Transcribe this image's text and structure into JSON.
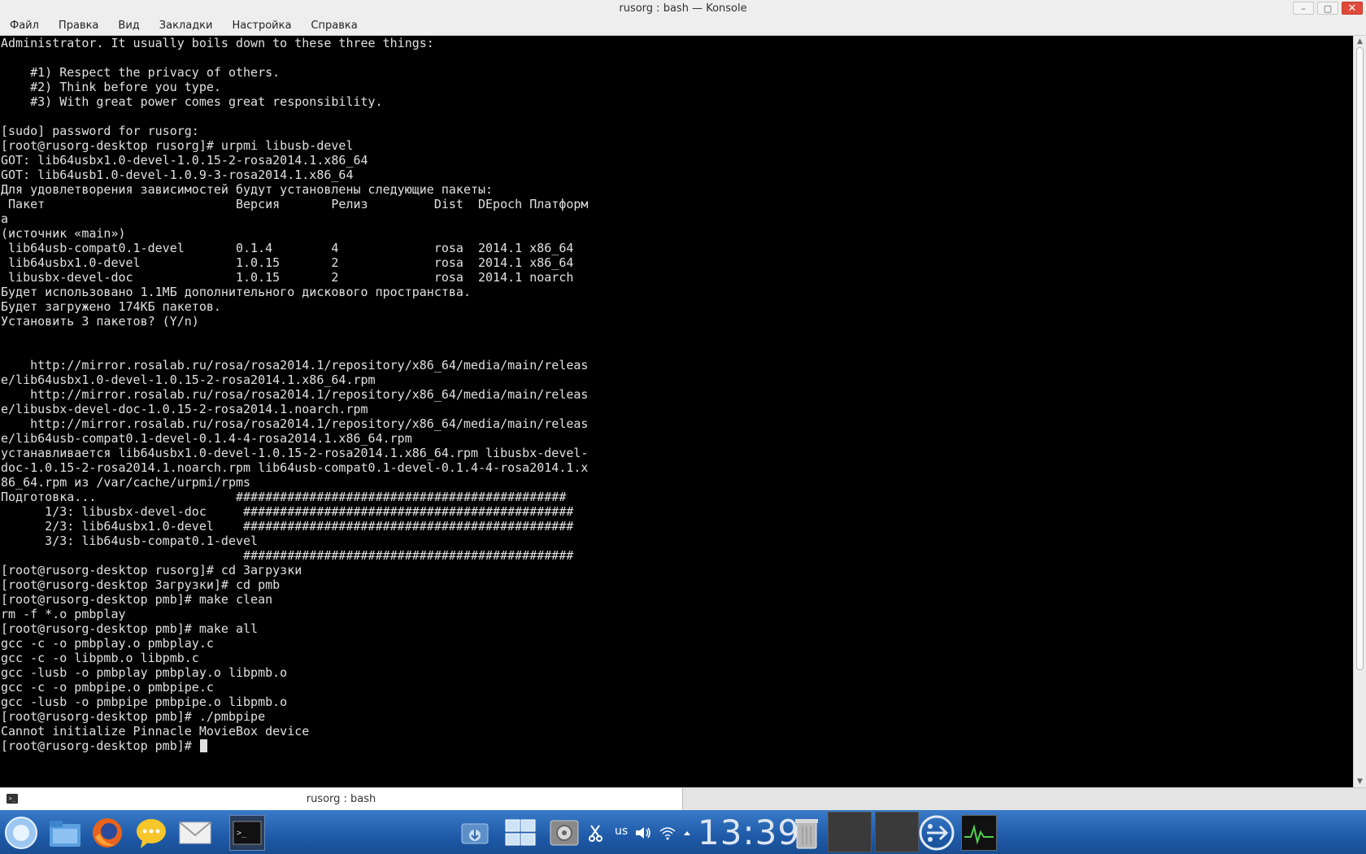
{
  "window": {
    "title": "rusorg : bash — Konsole",
    "controls": {
      "minimize": "–",
      "maximize": "▢",
      "close": "✕"
    }
  },
  "menubar": {
    "items": [
      "Файл",
      "Правка",
      "Вид",
      "Закладки",
      "Настройка",
      "Справка"
    ]
  },
  "terminal": {
    "lines": [
      "Administrator. It usually boils down to these three things:",
      "",
      "    #1) Respect the privacy of others.",
      "    #2) Think before you type.",
      "    #3) With great power comes great responsibility.",
      "",
      "[sudo] password for rusorg:",
      "[root@rusorg-desktop rusorg]# urpmi libusb-devel",
      "GOT: lib64usbx1.0-devel-1.0.15-2-rosa2014.1.x86_64",
      "GOT: lib64usb1.0-devel-1.0.9-3-rosa2014.1.x86_64",
      "Для удовлетворения зависимостей будут установлены следующие пакеты:",
      " Пакет                          Версия       Релиз         Dist  DEpoch Платформ",
      "а",
      "(источник «main»)",
      " lib64usb-compat0.1-devel       0.1.4        4             rosa  2014.1 x86_64",
      " lib64usbx1.0-devel             1.0.15       2             rosa  2014.1 x86_64",
      " libusbx-devel-doc              1.0.15       2             rosa  2014.1 noarch",
      "Будет использовано 1.1МБ дополнительного дискового пространства.",
      "Будет загружено 174КБ пакетов.",
      "Установить 3 пакетов? (Y/n)",
      "",
      "",
      "    http://mirror.rosalab.ru/rosa/rosa2014.1/repository/x86_64/media/main/releas",
      "e/lib64usbx1.0-devel-1.0.15-2-rosa2014.1.x86_64.rpm",
      "    http://mirror.rosalab.ru/rosa/rosa2014.1/repository/x86_64/media/main/releas",
      "e/libusbx-devel-doc-1.0.15-2-rosa2014.1.noarch.rpm",
      "    http://mirror.rosalab.ru/rosa/rosa2014.1/repository/x86_64/media/main/releas",
      "e/lib64usb-compat0.1-devel-0.1.4-4-rosa2014.1.x86_64.rpm",
      "устанавливается lib64usbx1.0-devel-1.0.15-2-rosa2014.1.x86_64.rpm libusbx-devel-",
      "doc-1.0.15-2-rosa2014.1.noarch.rpm lib64usb-compat0.1-devel-0.1.4-4-rosa2014.1.x",
      "86_64.rpm из /var/cache/urpmi/rpms",
      "Подготовка...                   #############################################",
      "      1/3: libusbx-devel-doc     #############################################",
      "      2/3: lib64usbx1.0-devel    #############################################",
      "      3/3: lib64usb-compat0.1-devel",
      "                                 #############################################",
      "[root@rusorg-desktop rusorg]# cd Загрузки",
      "[root@rusorg-desktop Загрузки]# cd pmb",
      "[root@rusorg-desktop pmb]# make clean",
      "rm -f *.o pmbplay",
      "[root@rusorg-desktop pmb]# make all",
      "gcc -c -o pmbplay.o pmbplay.c",
      "gcc -c -o libpmb.o libpmb.c",
      "gcc -lusb -o pmbplay pmbplay.o libpmb.o",
      "gcc -c -o pmbpipe.o pmbpipe.c",
      "gcc -lusb -o pmbpipe pmbpipe.o libpmb.o",
      "[root@rusorg-desktop pmb]# ./pmbpipe",
      "Cannot initialize Pinnacle MovieBox device"
    ],
    "prompt": "[root@rusorg-desktop pmb]# "
  },
  "tabbar": {
    "tab_label": "rusorg : bash"
  },
  "taskbar": {
    "clock": "13:39",
    "keyboard_layout": "us",
    "launchers": [
      "start-menu-icon",
      "file-manager-icon",
      "firefox-icon",
      "chat-icon",
      "mail-icon",
      "terminal-icon"
    ],
    "tray_icons": [
      "download-icon",
      "window-switcher-icon",
      "settings-icon",
      "clipboard-icon",
      "volume-icon",
      "wifi-icon",
      "tray-expand-icon",
      "trash-icon",
      "network-icon",
      "system-monitor-icon"
    ]
  }
}
